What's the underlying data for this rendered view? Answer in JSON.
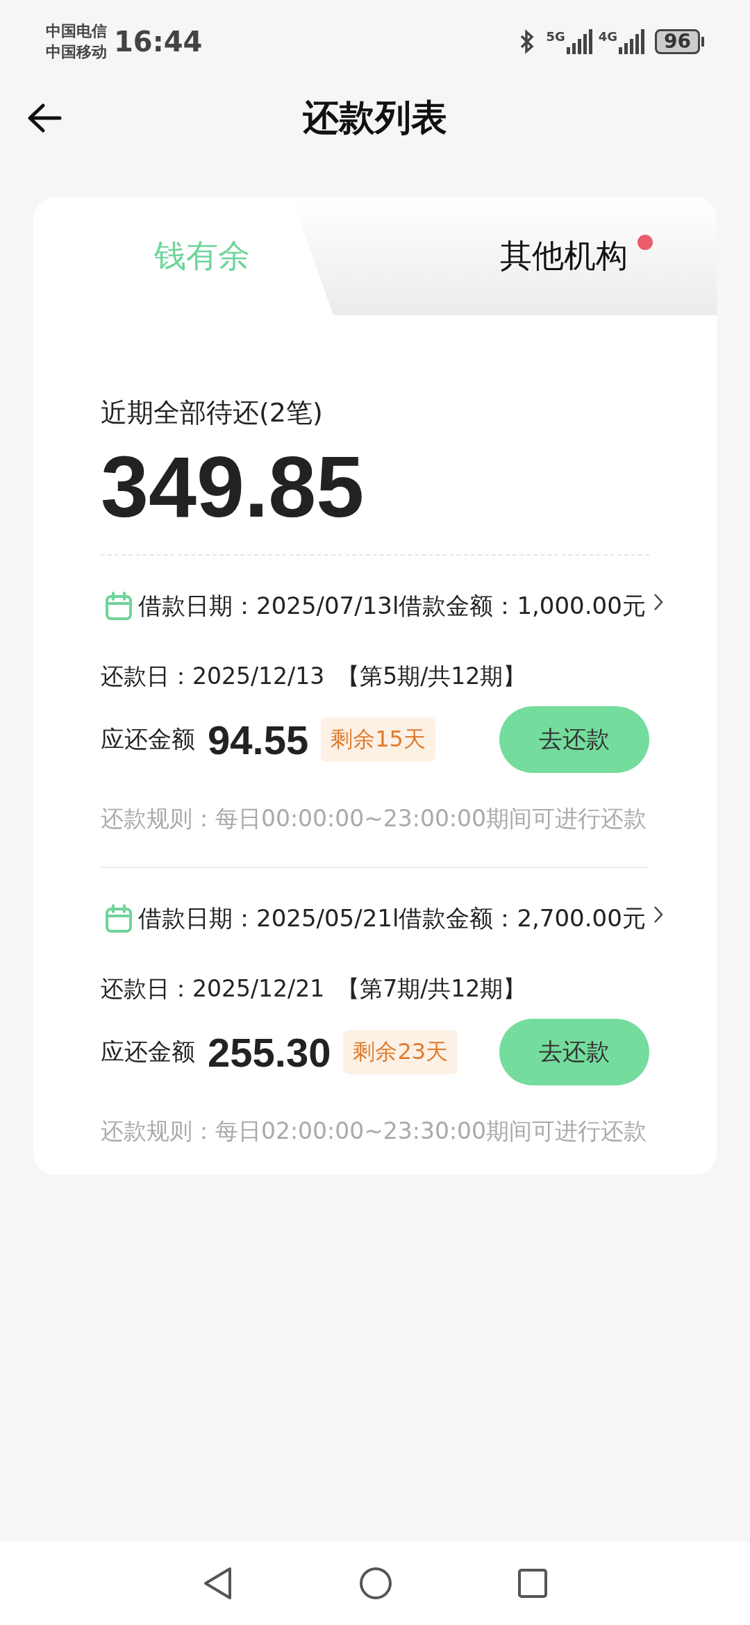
{
  "status_bar": {
    "carriers": [
      "中国电信",
      "中国移动"
    ],
    "time": "16:44",
    "networks": [
      "5G",
      "4G"
    ],
    "battery": "96"
  },
  "header": {
    "title": "还款列表"
  },
  "tabs": [
    {
      "label": "钱有余",
      "selected": true,
      "dot": false
    },
    {
      "label": "其他机构",
      "selected": false,
      "dot": true
    }
  ],
  "summary": {
    "label": "近期全部待还(2笔)",
    "amount": "349.85"
  },
  "loans": [
    {
      "info": "借款日期：2025/07/13l借款金额：1,000.00元",
      "due_date": "还款日：2025/12/13",
      "period": "【第5期/共12期】",
      "amount_label": "应还金额",
      "amount": "94.55",
      "remaining": "剩余15天",
      "button": "去还款",
      "rule": "还款规则：每日00:00:00~23:00:00期间可进行还款"
    },
    {
      "info": "借款日期：2025/05/21l借款金额：2,700.00元",
      "due_date": "还款日：2025/12/21",
      "period": "【第7期/共12期】",
      "amount_label": "应还金额",
      "amount": "255.30",
      "remaining": "剩余23天",
      "button": "去还款",
      "rule": "还款规则：每日02:00:00~23:30:00期间可进行还款"
    }
  ]
}
